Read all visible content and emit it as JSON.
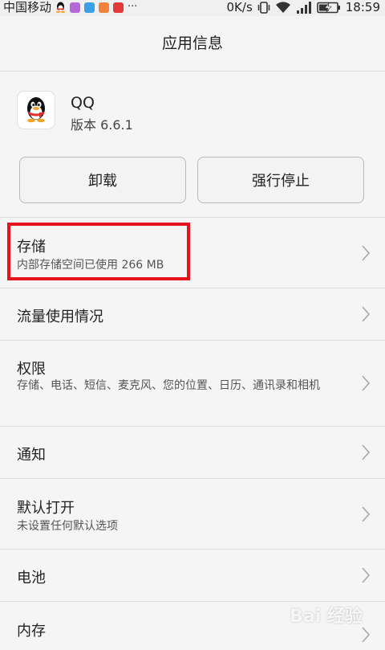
{
  "status_bar": {
    "carrier": "中国移动",
    "more": "···",
    "network_speed": "0K/s",
    "time": "18:59"
  },
  "header": {
    "title": "应用信息"
  },
  "app": {
    "name": "QQ",
    "version": "版本 6.6.1"
  },
  "buttons": {
    "uninstall": "卸载",
    "force_stop": "强行停止"
  },
  "items": [
    {
      "title": "存储",
      "subtitle": "内部存储空间已使用 266 MB"
    },
    {
      "title": "流量使用情况",
      "subtitle": ""
    },
    {
      "title": "权限",
      "subtitle": "存储、电话、短信、麦克风、您的位置、日历、通讯录和相机"
    },
    {
      "title": "通知",
      "subtitle": ""
    },
    {
      "title": "默认打开",
      "subtitle": "未设置任何默认选项"
    },
    {
      "title": "电池",
      "subtitle": ""
    },
    {
      "title": "内存",
      "subtitle": ""
    }
  ],
  "watermark": "Bai 经验",
  "colors": {
    "highlight": "#e8121d",
    "background": "#f5f5f5",
    "divider": "#dcdcdc"
  }
}
